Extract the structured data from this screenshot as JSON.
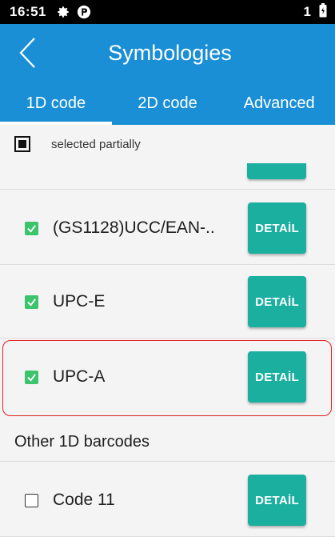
{
  "status_bar": {
    "time": "16:51",
    "icons_left": [
      "gear-icon",
      "app-indicator-icon"
    ],
    "sim_number": "1",
    "battery_icon": "battery-icon"
  },
  "app_bar": {
    "back_icon": "chevron-left-icon",
    "title": "Symbologies"
  },
  "tabs": [
    {
      "label": "1D code",
      "active": true
    },
    {
      "label": "2D code",
      "active": false
    },
    {
      "label": "Advanced",
      "active": false
    }
  ],
  "legend": {
    "label": "selected partially"
  },
  "rows": [
    {
      "label": "(GS1128)UCC/EAN-..",
      "checked": true,
      "button": "DETAİL"
    },
    {
      "label": "UPC-E",
      "checked": true,
      "button": "DETAİL"
    },
    {
      "label": "UPC-A",
      "checked": true,
      "button": "DETAİL",
      "highlighted": true
    }
  ],
  "section": {
    "title": "Other 1D barcodes"
  },
  "other_rows": [
    {
      "label": "Code 11",
      "checked": false,
      "button": "DETAİL"
    }
  ],
  "colors": {
    "status_bar": "#000000",
    "app_bar": "#1a8fd6",
    "button": "#1aaf9f",
    "checkbox_checked": "#3cc46c",
    "highlight": "#e02020",
    "background": "#f4f4f4"
  }
}
